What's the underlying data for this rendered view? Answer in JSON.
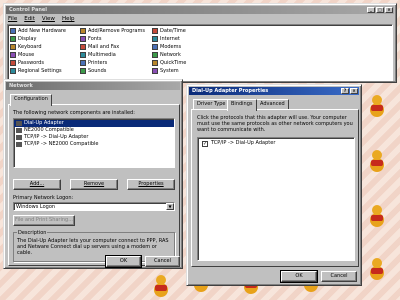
{
  "control_panel": {
    "title": "Control Panel",
    "menu": [
      "File",
      "Edit",
      "View",
      "Help"
    ],
    "columns": [
      [
        "Add New Hardware",
        "Display",
        "Keyboard",
        "Mouse",
        "Passwords",
        "Regional Settings"
      ],
      [
        "Add/Remove Programs",
        "Fonts",
        "Mail and Fax",
        "Multimedia",
        "Printers",
        "Sounds"
      ],
      [
        "Date/Time",
        "Internet",
        "Modems",
        "Network",
        "QuickTime",
        "System"
      ]
    ]
  },
  "network": {
    "title": "Network",
    "tab": "Configuration",
    "components_label": "The following network components are installed:",
    "components": [
      "Dial-Up Adapter",
      "NE2000 Compatible",
      "TCP/IP -> Dial-Up Adapter",
      "TCP/IP -> NE2000 Compatible"
    ],
    "add_label": "Add...",
    "remove_label": "Remove",
    "properties_label": "Properties",
    "logon_label": "Primary Network Logon:",
    "logon_value": "Windows Logon",
    "file_print_label": "File and Print Sharing...",
    "description_title": "Description",
    "description_text": "The Dial-Up Adapter lets your computer connect to PPP, RAS and Netware Connect dial up servers using a modem or cable.",
    "ok_label": "OK",
    "cancel_label": "Cancel"
  },
  "dialup_props": {
    "title": "Dial-Up Adapter Properties",
    "tabs": [
      "Driver Type",
      "Bindings",
      "Advanced"
    ],
    "instruction": "Click the protocols that this adapter will use. Your computer must use the same protocols as other network computers you want to communicate with.",
    "bindings": [
      {
        "label": "TCP/IP -> Dial-Up Adapter",
        "checked": true
      }
    ],
    "ok_label": "OK",
    "cancel_label": "Cancel"
  }
}
